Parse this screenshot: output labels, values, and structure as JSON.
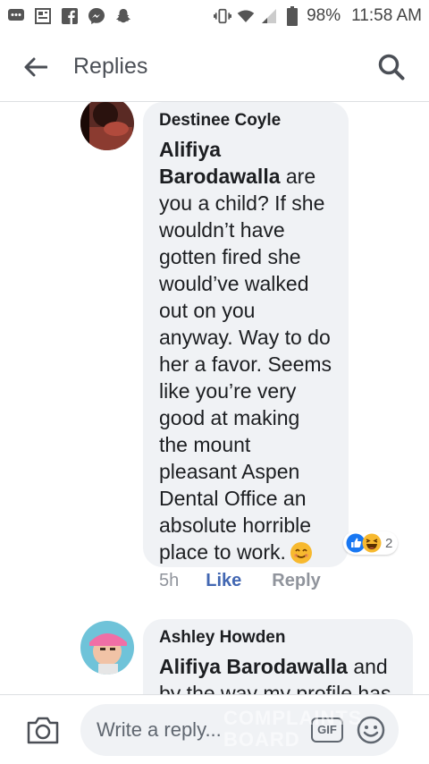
{
  "status_bar": {
    "left_icons": [
      "message-icon",
      "news-icon",
      "facebook-icon",
      "messenger-icon",
      "snapchat-icon"
    ],
    "right_icons": [
      "vibrate-icon",
      "wifi-icon",
      "signal-icon",
      "battery-icon"
    ],
    "battery": "98%",
    "time": "11:58 AM"
  },
  "header": {
    "title": "Replies"
  },
  "comments": [
    {
      "author": "Destinee Coyle",
      "mention": "Alifiya Barodawalla",
      "text": "are you a child? If she wouldn’t have gotten fired she would’ve walked out on you anyway. Way to do her a favor. Seems like you’re very good at making the mount pleasant Aspen Dental Office an absolute horrible place to work.",
      "reaction_count": "2",
      "time": "5h",
      "like_label": "Like",
      "reply_label": "Reply"
    },
    {
      "author": "Ashley Howden",
      "mention": "Alifiya Barodawalla",
      "text": "and by the way my profile has"
    }
  ],
  "composer": {
    "placeholder": "Write a reply...",
    "gif_label": "GIF"
  },
  "watermark": "COMPLAINTS BOARD",
  "colors": {
    "accent": "#4267b2",
    "bubble": "#f0f2f5",
    "meta_gray": "#90949c"
  }
}
